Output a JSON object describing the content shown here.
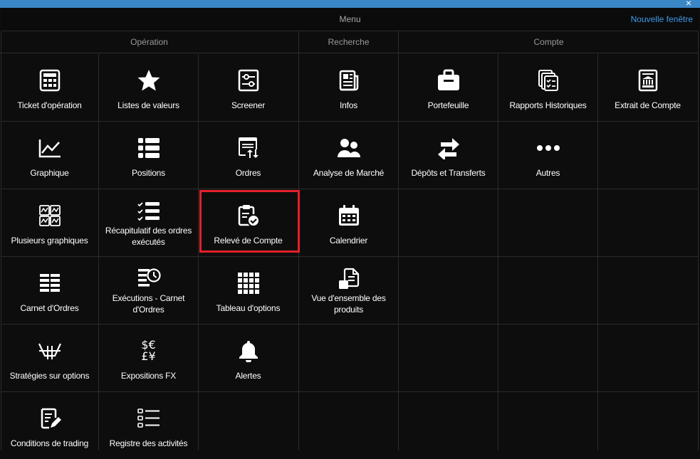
{
  "window": {
    "controls": "_ ×"
  },
  "menu": {
    "title": "Menu",
    "new_window": "Nouvelle fenêtre"
  },
  "sections": {
    "operation": "Opération",
    "recherche": "Recherche",
    "compte": "Compte"
  },
  "accent": "#3d9be9",
  "highlight_color": "#e3202a",
  "tiles": {
    "ticket": "Ticket d'opération",
    "listes": "Listes de valeurs",
    "screener": "Screener",
    "infos": "Infos",
    "portefeuille": "Portefeuille",
    "rapports": "Rapports Historiques",
    "extrait": "Extrait de Compte",
    "graphique": "Graphique",
    "positions": "Positions",
    "ordres": "Ordres",
    "analyse": "Analyse de Marché",
    "depots": "Dépôts et Transferts",
    "autres": "Autres",
    "plusieurs": "Plusieurs graphiques",
    "recap": "Récapitulatif des ordres exécutés",
    "releve": "Relevé de Compte",
    "calendrier": "Calendrier",
    "carnet": "Carnet d'Ordres",
    "executions": "Exécutions - Carnet d'Ordres",
    "tableau": "Tableau d'options",
    "vue": "Vue d'ensemble des produits",
    "strategies": "Stratégies sur options",
    "fx": "Expositions FX",
    "fx_icon_top": "$€",
    "fx_icon_bottom": "£¥",
    "alertes": "Alertes",
    "conditions": "Conditions de trading",
    "registre": "Registre des activités"
  }
}
